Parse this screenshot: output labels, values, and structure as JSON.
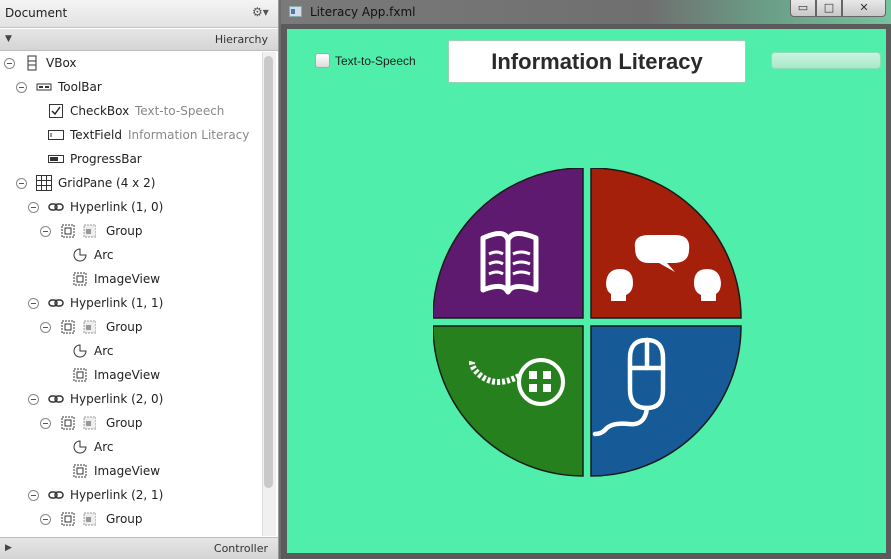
{
  "document_panel": {
    "title": "Document",
    "settings_glyph": "⚙▾",
    "hierarchy_label": "Hierarchy",
    "controller_label": "Controller",
    "tree": [
      {
        "label": "VBox",
        "value": "",
        "icon": "vbox-icon",
        "indent": 0,
        "expander": true
      },
      {
        "label": "ToolBar",
        "value": "",
        "icon": "toolbar-icon",
        "indent": 1,
        "expander": true
      },
      {
        "label": "CheckBox",
        "value": "Text-to-Speech",
        "icon": "checkbox-icon",
        "indent": 2,
        "expander": false
      },
      {
        "label": "TextField",
        "value": "Information Literacy",
        "icon": "textfield-icon",
        "indent": 2,
        "expander": false
      },
      {
        "label": "ProgressBar",
        "value": "",
        "icon": "progressbar-icon",
        "indent": 2,
        "expander": false
      },
      {
        "label": "GridPane (4 x 2)",
        "value": "",
        "icon": "gridpane-icon",
        "indent": 1,
        "expander": true
      },
      {
        "label": "Hyperlink (1, 0)",
        "value": "",
        "icon": "hyperlink-icon",
        "indent": 2,
        "expander": true
      },
      {
        "label": "Group",
        "value": "",
        "icon": "group-icon",
        "indent": 3,
        "expander": true
      },
      {
        "label": "Arc",
        "value": "",
        "icon": "arc-icon",
        "indent": 4,
        "expander": false
      },
      {
        "label": "ImageView",
        "value": "",
        "icon": "imageview-icon",
        "indent": 4,
        "expander": false
      },
      {
        "label": "Hyperlink (1, 1)",
        "value": "",
        "icon": "hyperlink-icon",
        "indent": 2,
        "expander": true
      },
      {
        "label": "Group",
        "value": "",
        "icon": "group-icon",
        "indent": 3,
        "expander": true
      },
      {
        "label": "Arc",
        "value": "",
        "icon": "arc-icon",
        "indent": 4,
        "expander": false
      },
      {
        "label": "ImageView",
        "value": "",
        "icon": "imageview-icon",
        "indent": 4,
        "expander": false
      },
      {
        "label": "Hyperlink (2, 0)",
        "value": "",
        "icon": "hyperlink-icon",
        "indent": 2,
        "expander": true
      },
      {
        "label": "Group",
        "value": "",
        "icon": "group-icon",
        "indent": 3,
        "expander": true
      },
      {
        "label": "Arc",
        "value": "",
        "icon": "arc-icon",
        "indent": 4,
        "expander": false
      },
      {
        "label": "ImageView",
        "value": "",
        "icon": "imageview-icon",
        "indent": 4,
        "expander": false
      },
      {
        "label": "Hyperlink (2, 1)",
        "value": "",
        "icon": "hyperlink-icon",
        "indent": 2,
        "expander": true
      },
      {
        "label": "Group",
        "value": "",
        "icon": "group-icon",
        "indent": 3,
        "expander": true
      }
    ]
  },
  "app_window": {
    "title": "Literacy App.fxml",
    "controls": {
      "minimize": "▭",
      "maximize": "□",
      "close": "✕"
    },
    "toolbar": {
      "checkbox_label": "Text-to-Speech",
      "checkbox_checked": false,
      "title_field_value": "Information Literacy",
      "progress": 0
    },
    "background_color": "#50eeab",
    "quadrants": [
      {
        "name": "reading",
        "color": "#5e1a6e",
        "icon": "open-book-icon"
      },
      {
        "name": "conversation",
        "color": "#a5200a",
        "icon": "speech-bubble-people-icon"
      },
      {
        "name": "media",
        "color": "#27801e",
        "icon": "film-reel-icon"
      },
      {
        "name": "computer",
        "color": "#165a98",
        "icon": "computer-mouse-icon"
      }
    ]
  }
}
